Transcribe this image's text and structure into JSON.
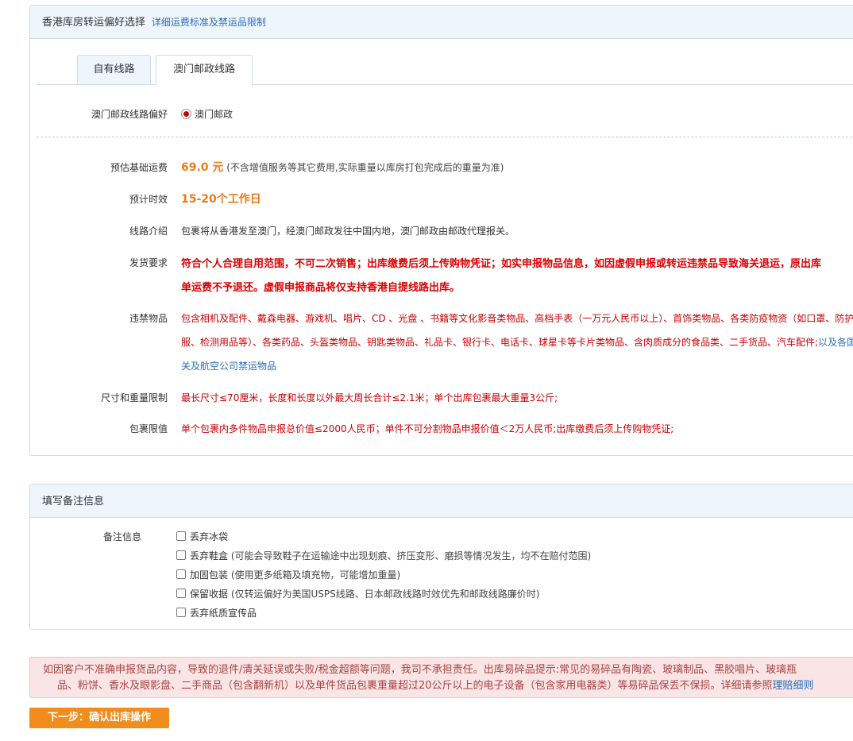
{
  "route_panel": {
    "title": "香港库房转运偏好选择",
    "link": "详细运费标准及禁运品限制",
    "tabs": [
      {
        "label": "自有线路",
        "active": false
      },
      {
        "label": "澳门邮政线路",
        "active": true
      }
    ],
    "preference_label": "澳门邮政线路偏好",
    "preference_option": "澳门邮政",
    "fee_label": "预估基础运费",
    "fee_value": "69.0 元",
    "fee_note": "(不含增值服务等其它费用,实际重量以库房打包完成后的重量为准)",
    "time_label": "预计时效",
    "time_value": "15-20个工作日",
    "intro_label": "线路介绍",
    "intro_value": "包裹将从香港发至澳门，经澳门邮政发往中国内地，澳门邮政由邮政代理报关。",
    "req_label": "发货要求",
    "req_line1": "符合个人合理自用范围，不可二次销售；出库缴费后须上传购物凭证；如实申报物品信息，如因虚假申报或转运违禁品导致海关退运，原出库",
    "req_line2": "单运费不予退还。虚假申报商品将仅支持香港自提线路出库。",
    "prohibited_label": "违禁物品",
    "prohibited_line1": "包含相机及配件、戴森电器、游戏机、唱片、CD 、光盘 、书籍等文化影音类物品、高档手表（一万元人民币以上）、首饰类物品、各类防疫物资（如口罩、防护",
    "prohibited_line2_red": "服、检测用品等）、各类药品、头盔类物品、钥匙类物品、礼品卡、银行卡、电话卡、球星卡等卡片类物品、含肉质成分的食品类、二手货品、汽车配件;",
    "prohibited_line2_blue": "以及各国海",
    "prohibited_line3": "关及航空公司禁运物品",
    "size_label": "尺寸和重量限制",
    "size_value": "最长尺寸≤70厘米，长度和长度以外最大周长合计≤2.1米；单个出库包裹最大重量3公斤;",
    "limit_label": "包裹限值",
    "limit_value": "单个包裹内多件物品申报总价值≤2000人民币；单件不可分割物品申报价值＜2万人民币;出库缴费后须上传购物凭证;"
  },
  "notes_panel": {
    "title": "填写备注信息",
    "label": "备注信息",
    "options": [
      {
        "label": "丢弃冰袋",
        "sub": "",
        "checked": false
      },
      {
        "label": "丢弃鞋盒",
        "sub": "(可能会导致鞋子在运输途中出现划痕、挤压变形、磨损等情况发生，均不在赔付范围)",
        "checked": false
      },
      {
        "label": "加固包装",
        "sub": "(使用更多纸箱及填充物，可能增加重量)",
        "checked": false
      },
      {
        "label": "保留收据",
        "sub": "(仅转运偏好为美国USPS线路、日本邮政线路时效优先和邮政线路廉价时)",
        "checked": false
      },
      {
        "label": "丢弃纸质宣传品",
        "sub": "",
        "checked": false
      }
    ]
  },
  "warning": {
    "line1": "如因客户不准确申报货品内容，导致的退件/清关延误或失败/税金超额等问题，我司不承担责任。出库易碎品提示:常见的易碎品有陶瓷、玻璃制品、黑胶唱片、玻璃瓶",
    "line2": "品、粉饼、香水及眼影盘、二手商品（包含翻新机）以及单件货品包裹重量超过20公斤以上的电子设备（包含家用电器类）等易碎品保丢不保损。详细请参照",
    "link": "理赔细则"
  },
  "next_button": "下一步：确认出库操作",
  "colors": {
    "accent_orange": "#f28c1c",
    "price_orange": "#ee7b13",
    "alert_red": "#cc0000",
    "link_blue": "#2a6ebb",
    "panel_header_bg": "#eef5fb",
    "warning_bg": "#f9e5e5"
  }
}
